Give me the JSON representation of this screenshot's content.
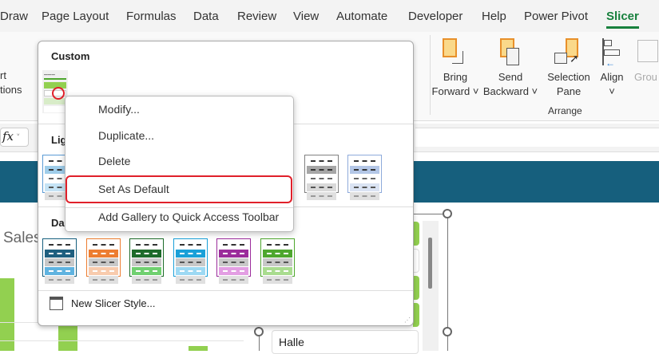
{
  "ribbon_tabs": [
    "Draw",
    "Page Layout",
    "Formulas",
    "Data",
    "Review",
    "View",
    "Automate",
    "Developer",
    "Help",
    "Power Pivot",
    "Slicer"
  ],
  "active_tab": "Slicer",
  "ribbon": {
    "left_partial_1": "rt",
    "left_partial_2": "tions",
    "bring_forward": [
      "Bring",
      "Forward"
    ],
    "send_backward": [
      "Send",
      "Backward"
    ],
    "selection_pane": [
      "Selection",
      "Pane"
    ],
    "align": "Align",
    "group": "Grou",
    "group_label": "Arrange"
  },
  "formula_bar": {
    "fx": "fx"
  },
  "gallery": {
    "custom_title": "Custom",
    "light_title": "Lig",
    "dark_title": "Da",
    "new_style": "New Slicer Style...",
    "light_styles": [
      [
        "#5b9bd5",
        "#9fcdea",
        "#c5e3f5"
      ],
      [
        "#808080",
        "#a6a6a6",
        "#d9d9d9"
      ],
      [
        "#8eaadb",
        "#b4c7e7",
        "#dae3f3"
      ]
    ],
    "dark_styles": [
      [
        "#17607f",
        "#1f5f7f",
        "#5fb3e0"
      ],
      [
        "#ed7d31",
        "#ed7d31",
        "#f8cbad"
      ],
      [
        "#1d6b2a",
        "#1d6b2a",
        "#70d070"
      ],
      [
        "#1aa0d8",
        "#1aa0d8",
        "#9dd9f3"
      ],
      [
        "#9b2c9b",
        "#9b2c9b",
        "#e39ee3"
      ],
      [
        "#4ea72e",
        "#4ea72e",
        "#a9dc8f"
      ]
    ]
  },
  "context_menu": {
    "items": [
      "Modify...",
      "Duplicate...",
      "Delete",
      "Set As Default",
      "Add Gallery to Quick Access Toolbar"
    ],
    "highlighted": "Set As Default"
  },
  "sheet": {
    "chart_title_partial": "Sales",
    "slicer_item": "Halle"
  },
  "colors": {
    "accent": "#17803d",
    "band": "#165f7d",
    "highlight": "#e0202a",
    "bar": "#92d050"
  }
}
